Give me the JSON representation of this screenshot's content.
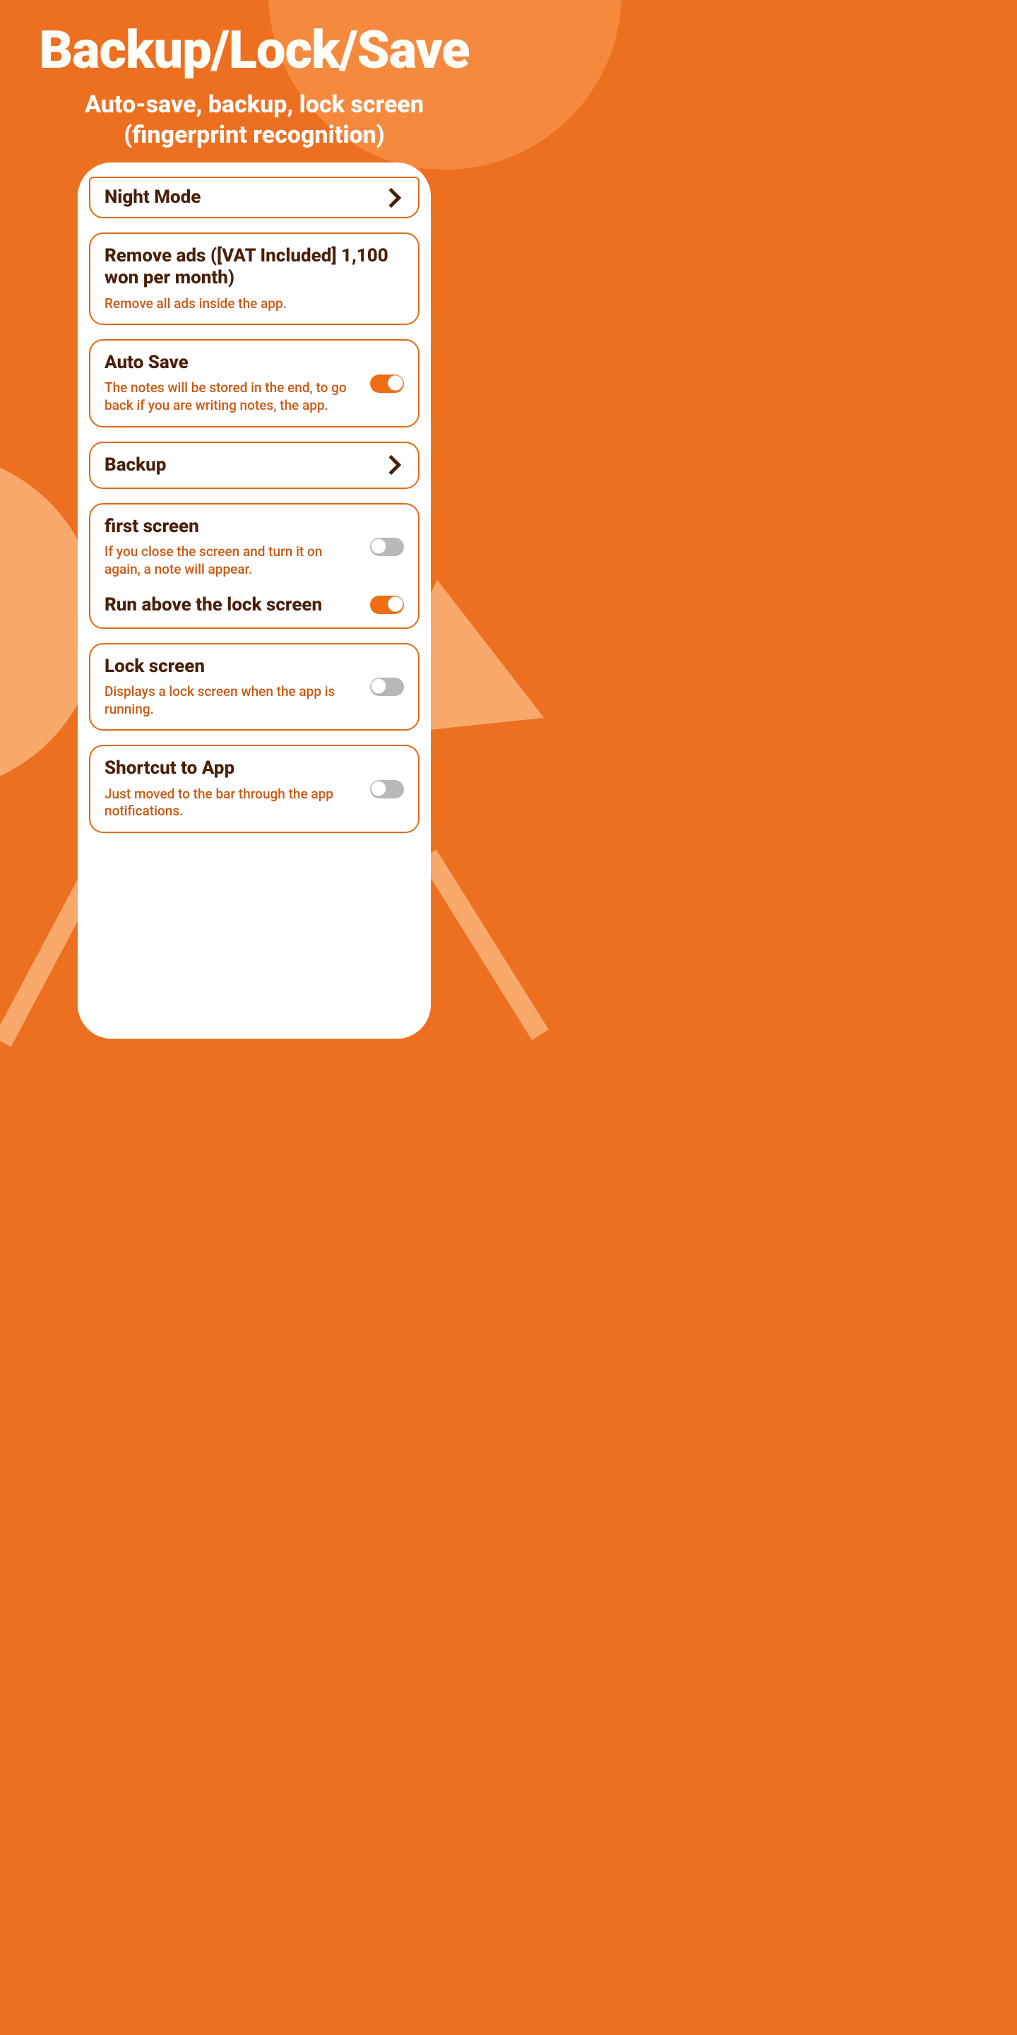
{
  "header": {
    "title": "Backup/Lock/Save",
    "subtitle_line1": "Auto-save, backup, lock screen",
    "subtitle_line2": "(fingerprint recognition)"
  },
  "settings": {
    "night_mode": {
      "title": "Night Mode"
    },
    "remove_ads": {
      "title": "Remove ads ([VAT Included] 1,100 won per month)",
      "subtitle": "Remove all ads inside the app."
    },
    "auto_save": {
      "title": "Auto Save",
      "subtitle": "The notes will be stored in the end, to go back if you are writing notes, the app.",
      "enabled": true
    },
    "backup": {
      "title": "Backup"
    },
    "first_screen": {
      "title": "first screen",
      "subtitle": "If you close the screen and turn it on again, a note will appear.",
      "enabled": false
    },
    "run_above_lock": {
      "title": "Run above the lock screen",
      "enabled": true
    },
    "lock_screen": {
      "title": "Lock screen",
      "subtitle": "Displays a lock screen when the app is running.",
      "enabled": false
    },
    "shortcut": {
      "title": "Shortcut to App",
      "subtitle": "Just moved to the bar through the app notifications.",
      "enabled": false
    }
  }
}
